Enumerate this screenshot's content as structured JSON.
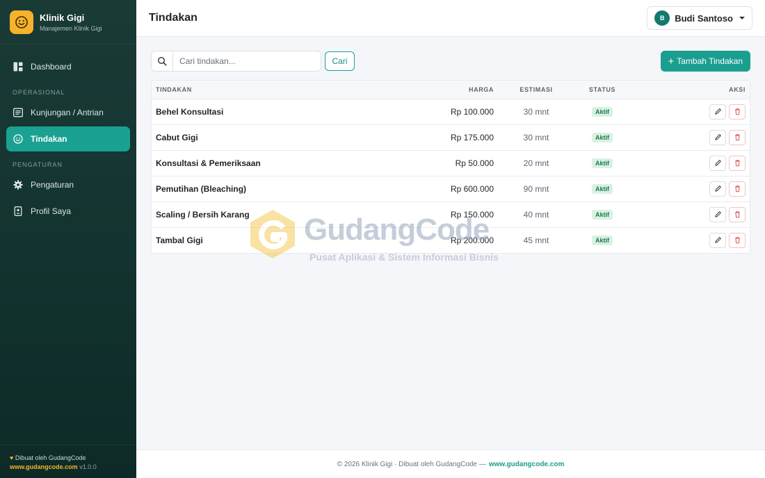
{
  "brand": {
    "name": "Klinik Gigi",
    "subtitle": "Manajemen Klinik Gigi"
  },
  "sidebar": {
    "items": [
      {
        "label": "Dashboard"
      },
      {
        "label": "Kunjungan / Antrian"
      },
      {
        "label": "Tindakan"
      },
      {
        "label": "Pengaturan"
      },
      {
        "label": "Profil Saya"
      }
    ],
    "sections": {
      "operasional": "OPERASIONAL",
      "pengaturan": "PENGATURAN"
    },
    "footer": {
      "made_by": "Dibuat oleh GudangCode",
      "site": "www.gudangcode.com",
      "version": "v1.0.0"
    }
  },
  "header": {
    "title": "Tindakan",
    "user_name": "Budi Santoso",
    "user_initial": "B"
  },
  "toolbar": {
    "search_placeholder": "Cari tindakan...",
    "search_button": "Cari",
    "add_button": "Tambah Tindakan"
  },
  "table": {
    "columns": [
      "TINDAKAN",
      "HARGA",
      "ESTIMASI",
      "STATUS",
      "AKSI"
    ],
    "rows": [
      {
        "name": "Behel Konsultasi",
        "price": "Rp 100.000",
        "estimate": "30 mnt",
        "status": "Aktif"
      },
      {
        "name": "Cabut Gigi",
        "price": "Rp 175.000",
        "estimate": "30 mnt",
        "status": "Aktif"
      },
      {
        "name": "Konsultasi & Pemeriksaan",
        "price": "Rp 50.000",
        "estimate": "20 mnt",
        "status": "Aktif"
      },
      {
        "name": "Pemutihan (Bleaching)",
        "price": "Rp 600.000",
        "estimate": "90 mnt",
        "status": "Aktif"
      },
      {
        "name": "Scaling / Bersih Karang",
        "price": "Rp 150.000",
        "estimate": "40 mnt",
        "status": "Aktif"
      },
      {
        "name": "Tambal Gigi",
        "price": "Rp 200.000",
        "estimate": "45 mnt",
        "status": "Aktif"
      }
    ]
  },
  "watermark": {
    "name": "GudangCode",
    "tagline": "Pusat Aplikasi & Sistem Informasi Bisnis"
  },
  "footer": {
    "text": "© 2026 Klinik Gigi · Dibuat oleh GudangCode —",
    "site": "www.gudangcode.com"
  },
  "colors": {
    "sidebar_bg": "#12332f",
    "accent": "#1a9e8f",
    "brand_logo": "#f4b32a",
    "badge_bg": "#d9f1e3",
    "badge_text": "#1c7a4b",
    "delete": "#e05252"
  }
}
